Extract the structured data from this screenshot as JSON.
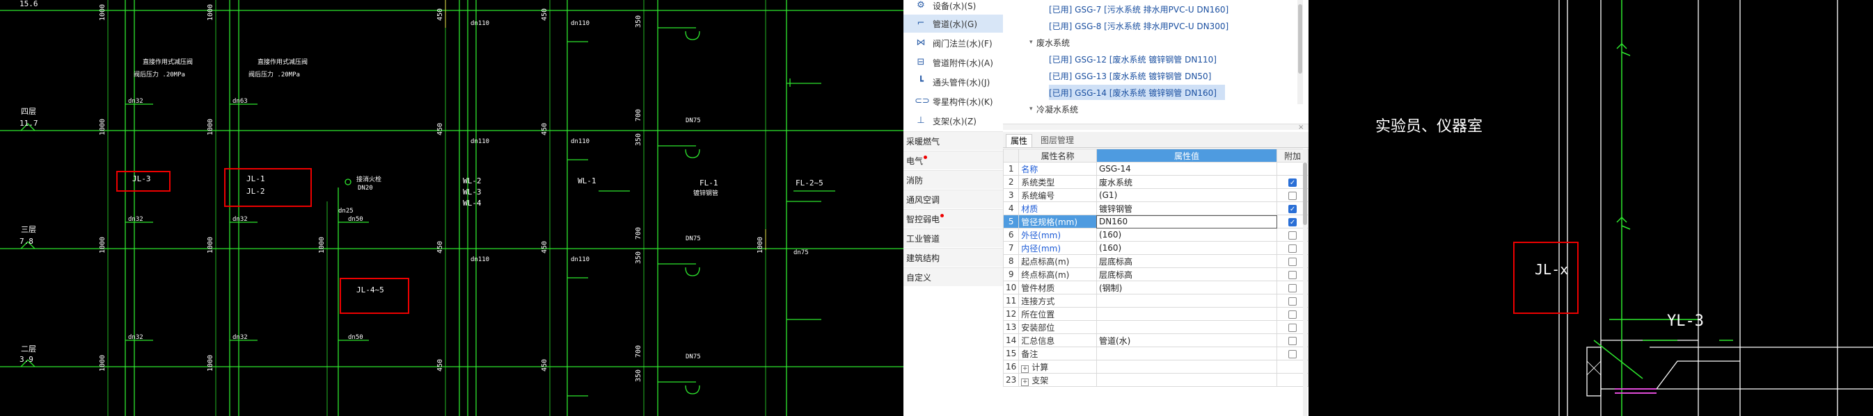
{
  "left_drawing": {
    "labels": {
      "top_level": "15.6",
      "level_4f": "四层",
      "elev_11_7": "11.7",
      "level_3f": "三层",
      "elev_7_8": "7.8",
      "level_2f": "二层",
      "elev_3_9": "3.9",
      "valve_a_line1": "直接作用式减压阀",
      "valve_a_line2": "阀后压力 .20MPa",
      "valve_b_line1": "直接作用式减压阀",
      "valve_b_line2": "阀后压力 .20MPa",
      "jl3": "JL-3",
      "jl1": "JL-1",
      "jl2": "JL-2",
      "jl45": "JL-4~5",
      "wl2": "WL-2",
      "wl3": "WL-3",
      "wl4": "WL-4",
      "wl1": "WL-1",
      "fl1": "FL-1",
      "fl1_note": "镀锌钢管",
      "fl25": "FL-2~5",
      "hydrant": "接消火栓",
      "hydrant_dn": "DN20",
      "d1000": "1000",
      "d350": "350",
      "d450": "450",
      "d700": "700",
      "dn32": "dn32",
      "dn50": "dn50",
      "dn63": "dn63",
      "dn110": "dn110",
      "dn75": "dn75",
      "dN75": "DN75",
      "dn25": "dn25"
    }
  },
  "toolbar": {
    "items": [
      {
        "label": "设备(水)(S)",
        "icon": "equipment-icon"
      },
      {
        "label": "管道(水)(G)",
        "icon": "pipe-icon",
        "selected": true
      },
      {
        "label": "阀门法兰(水)(F)",
        "icon": "valve-icon"
      },
      {
        "label": "管道附件(水)(A)",
        "icon": "pipe-accessory-icon"
      },
      {
        "label": "通头管件(水)(J)",
        "icon": "fitting-icon"
      },
      {
        "label": "零星构件(水)(K)",
        "icon": "misc-component-icon"
      },
      {
        "label": "支架(水)(Z)",
        "icon": "bracket-icon"
      }
    ],
    "categories": [
      {
        "label": "采暖燃气",
        "alert": false
      },
      {
        "label": "电气",
        "alert": true
      },
      {
        "label": "消防",
        "alert": false
      },
      {
        "label": "通风空调",
        "alert": false
      },
      {
        "label": "智控弱电",
        "alert": true
      },
      {
        "label": "工业管道",
        "alert": false
      },
      {
        "label": "建筑结构",
        "alert": false
      },
      {
        "label": "自定义",
        "alert": false
      }
    ]
  },
  "tree": {
    "rows": [
      {
        "text": "[已用] GSG-7 [污水系统 排水用PVC-U DN160]",
        "type": "item"
      },
      {
        "text": "[已用] GSG-8 [污水系统 排水用PVC-U DN300]",
        "type": "item"
      },
      {
        "text": "废水系统",
        "type": "group"
      },
      {
        "text": "[已用] GSG-12 [废水系统 镀锌钢管 DN110]",
        "type": "item"
      },
      {
        "text": "[已用] GSG-13 [废水系统 镀锌钢管 DN50]",
        "type": "item"
      },
      {
        "text": "[已用] GSG-14 [废水系统 镀锌钢管 DN160]",
        "type": "item",
        "selected": true
      },
      {
        "text": "冷凝水系统",
        "type": "group"
      }
    ]
  },
  "properties": {
    "tabs": [
      "属性",
      "图层管理"
    ],
    "headers": {
      "name": "属性名称",
      "value": "属性值",
      "extra": "附加"
    },
    "rows": [
      {
        "num": "1",
        "name": "名称",
        "value": "GSG-14",
        "blue": true,
        "check": null
      },
      {
        "num": "2",
        "name": "系统类型",
        "value": "废水系统",
        "blue": false,
        "check": true
      },
      {
        "num": "3",
        "name": "系统编号",
        "value": "(G1)",
        "blue": false,
        "check": false
      },
      {
        "num": "4",
        "name": "材质",
        "value": "镀锌钢管",
        "blue": true,
        "check": true
      },
      {
        "num": "5",
        "name": "管径规格(mm)",
        "value": "DN160",
        "blue": true,
        "check": true,
        "selected": true
      },
      {
        "num": "6",
        "name": "外径(mm)",
        "value": "(160)",
        "blue": true,
        "check": false
      },
      {
        "num": "7",
        "name": "内径(mm)",
        "value": "(160)",
        "blue": true,
        "check": false
      },
      {
        "num": "8",
        "name": "起点标高(m)",
        "value": "层底标高",
        "blue": false,
        "check": false
      },
      {
        "num": "9",
        "name": "终点标高(m)",
        "value": "层底标高",
        "blue": false,
        "check": false
      },
      {
        "num": "10",
        "name": "管件材质",
        "value": "(钢制)",
        "blue": false,
        "check": false
      },
      {
        "num": "11",
        "name": "连接方式",
        "value": "",
        "blue": false,
        "check": false
      },
      {
        "num": "12",
        "name": "所在位置",
        "value": "",
        "blue": false,
        "check": false
      },
      {
        "num": "13",
        "name": "安装部位",
        "value": "",
        "blue": false,
        "check": false
      },
      {
        "num": "14",
        "name": "汇总信息",
        "value": "管道(水)",
        "blue": false,
        "check": false
      },
      {
        "num": "15",
        "name": "备注",
        "value": "",
        "blue": false,
        "check": false
      },
      {
        "num": "16",
        "name": "计算",
        "value": "",
        "blue": false,
        "check": null,
        "expand": true
      },
      {
        "num": "23",
        "name": "支架",
        "value": "",
        "blue": false,
        "check": null,
        "expand": true
      }
    ]
  },
  "right_drawing": {
    "room_label": "实验员、仪器室",
    "jlx": "JL-x",
    "yl3": "YL-3"
  },
  "colors": {
    "cad_green": "#2ee82e",
    "cad_yellow": "#e8e84a",
    "annotation_red": "#e00000",
    "selection_blue": "#4e9be0"
  }
}
